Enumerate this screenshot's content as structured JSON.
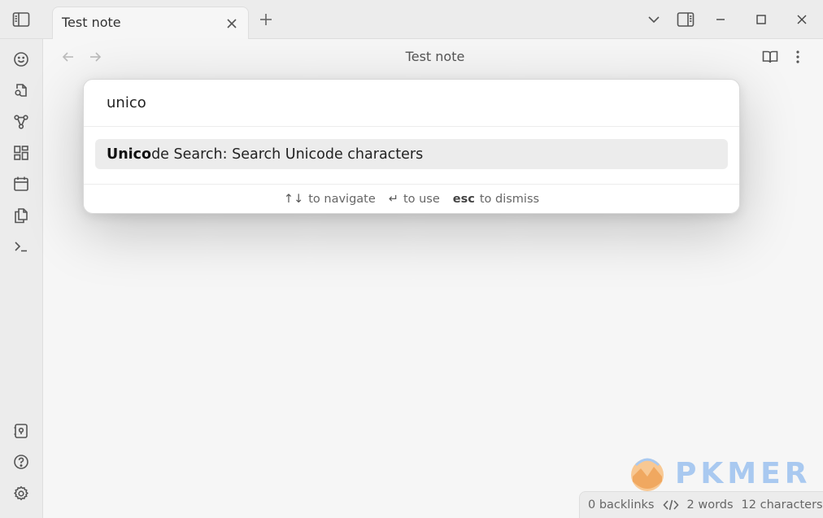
{
  "tab": {
    "title": "Test note"
  },
  "view": {
    "title": "Test note"
  },
  "palette": {
    "query": "unico",
    "suggestion": {
      "match": "Unico",
      "rest": "de Search: Search Unicode characters"
    },
    "hints": [
      {
        "key": "↑↓",
        "label": "to navigate"
      },
      {
        "key": "↵",
        "label": "to use"
      },
      {
        "key": "esc",
        "label": "to dismiss"
      }
    ]
  },
  "status": {
    "backlinks": "0 backlinks",
    "words": "2 words",
    "characters": "12 characters"
  },
  "watermark": {
    "text": "PKMER"
  },
  "icons": {
    "ribbon_top": [
      "sidebar-toggle-icon"
    ],
    "ribbon": [
      "face-icon",
      "file-search-icon",
      "graph-icon",
      "grid-icon",
      "calendar-icon",
      "copy-icon",
      "terminal-icon"
    ],
    "ribbon_bottom": [
      "vault-icon",
      "help-icon",
      "settings-icon"
    ]
  },
  "colors": {
    "accent": "#a9c9f0",
    "background": "#f6f6f6",
    "chrome": "#ececec"
  }
}
